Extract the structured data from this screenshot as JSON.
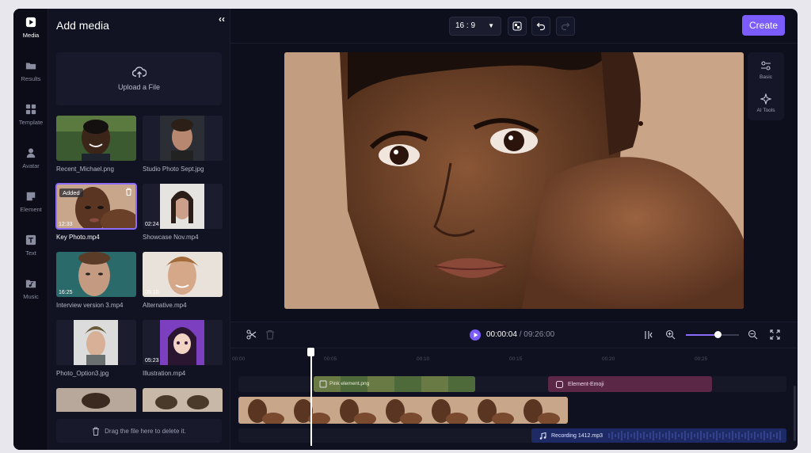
{
  "rail": [
    {
      "label": "Media",
      "icon": "play-square-icon",
      "active": true
    },
    {
      "label": "Results",
      "icon": "folder-icon"
    },
    {
      "label": "Template",
      "icon": "grid-icon"
    },
    {
      "label": "Avatar",
      "icon": "person-icon"
    },
    {
      "label": "Element",
      "icon": "sticker-icon"
    },
    {
      "label": "Text",
      "icon": "text-t-icon"
    },
    {
      "label": "Music",
      "icon": "music-folder-icon"
    }
  ],
  "panel": {
    "title": "Add media",
    "collapse": "‹‹",
    "upload_label": "Upload a File",
    "drop_hint": "Drag the file here to delete it."
  },
  "media": [
    {
      "name": "Recent_Michael.png",
      "duration": "",
      "badge": ""
    },
    {
      "name": "Studio Photo Sept.jpg",
      "duration": "",
      "badge": ""
    },
    {
      "name": "Key Photo.mp4",
      "duration": "12:33",
      "badge": "Added",
      "selected": true
    },
    {
      "name": "Showcase Nov.mp4",
      "duration": "02:24",
      "badge": ""
    },
    {
      "name": "Interview version 3.mp4",
      "duration": "16:25",
      "badge": ""
    },
    {
      "name": "Alternative.mp4",
      "duration": "05:10",
      "badge": ""
    },
    {
      "name": "Photo_Option3.jpg",
      "duration": "",
      "badge": ""
    },
    {
      "name": "Illustration.mp4",
      "duration": "05:23",
      "badge": ""
    },
    {
      "name": "",
      "duration": "",
      "badge": ""
    },
    {
      "name": "",
      "duration": "",
      "badge": ""
    }
  ],
  "topbar": {
    "ratio": "16 : 9",
    "create": "Create"
  },
  "side_tools": [
    {
      "label": "Basic",
      "icon": "sliders-icon"
    },
    {
      "label": "AI Tools",
      "icon": "sparkle-icon"
    }
  ],
  "timeline": {
    "current": "00:00:04",
    "total": " / 09:26:00",
    "zoom_level": 0.6,
    "ticks": [
      "00:00",
      "00:05",
      "00:10",
      "00:15",
      "00:20",
      "00:25"
    ],
    "overlay_label": "Pink element.png",
    "emoji_label": "Element-Emoji",
    "audio_label": "Recording 1412.mp3"
  },
  "colors": {
    "accent": "#7a5cff",
    "background": "#0d0f1c",
    "panel": "#111322"
  }
}
